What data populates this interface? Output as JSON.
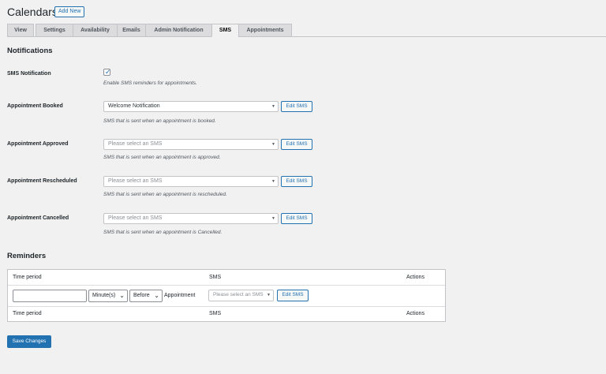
{
  "header": {
    "title": "Calendars",
    "add_new": "Add New"
  },
  "tabs": [
    {
      "label": "View",
      "active": false
    },
    {
      "label": "Settings",
      "active": false
    },
    {
      "label": "Availability",
      "active": false
    },
    {
      "label": "Emails",
      "active": false
    },
    {
      "label": "Admin Notification",
      "active": false
    },
    {
      "label": "SMS",
      "active": true
    },
    {
      "label": "Appointments",
      "active": false
    }
  ],
  "notifications": {
    "title": "Notifications",
    "sms_notification": {
      "label": "SMS Notification",
      "checked": true,
      "description": "Enable SMS reminders for appointments."
    },
    "rows": [
      {
        "label": "Appointment Booked",
        "value": "Welcome Notification",
        "is_placeholder": false,
        "button": "Edit SMS",
        "description": "SMS that is sent when an appointment is booked."
      },
      {
        "label": "Appointment Approved",
        "value": "Please select an SMS",
        "is_placeholder": true,
        "button": "Edit SMS",
        "description": "SMS that is sent when an appointment is approved."
      },
      {
        "label": "Appointment Rescheduled",
        "value": "Please select an SMS",
        "is_placeholder": true,
        "button": "Edit SMS",
        "description": "SMS that is sent when an appointment is rescheduled."
      },
      {
        "label": "Appointment Cancelled",
        "value": "Please select an SMS",
        "is_placeholder": true,
        "button": "Edit SMS",
        "description": "SMS that is sent when an appointment is Cancelled."
      }
    ]
  },
  "reminders": {
    "title": "Reminders",
    "columns": [
      "Time period",
      "SMS",
      "Actions"
    ],
    "row": {
      "time_value": "",
      "unit": "Minute(s)",
      "relation": "Before",
      "suffix": "Appointment",
      "sms_placeholder": "Please select an SMS",
      "button": "Edit SMS"
    },
    "footer_columns": [
      "Time period",
      "SMS",
      "Actions"
    ]
  },
  "save_button": "Save Changes",
  "colors": {
    "accent": "#2271b1",
    "background": "#f1f1f1"
  }
}
